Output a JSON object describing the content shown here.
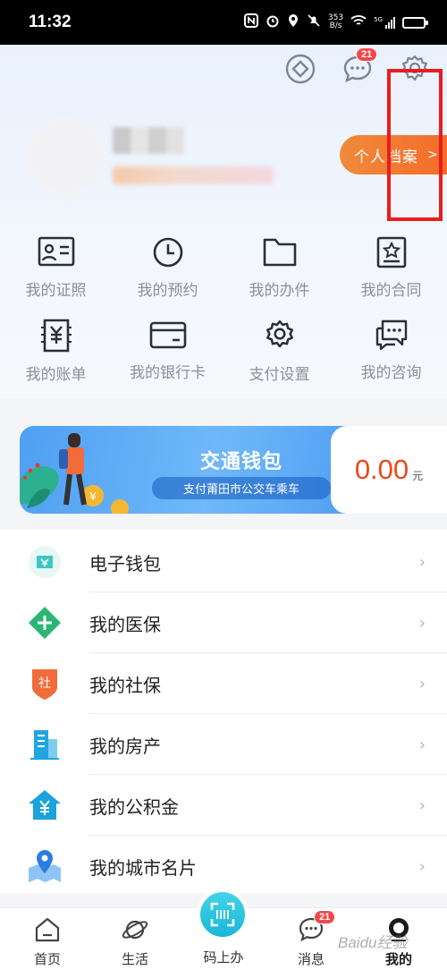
{
  "status": {
    "time": "11:32",
    "net_speed": "353",
    "net_unit": "B/s",
    "five_g": "5G"
  },
  "header": {
    "messages_badge": "21",
    "profile_button": "个人档案"
  },
  "services": [
    {
      "label": "我的证照",
      "icon": "id-card-icon"
    },
    {
      "label": "我的预约",
      "icon": "clock-icon"
    },
    {
      "label": "我的办件",
      "icon": "folder-icon"
    },
    {
      "label": "我的合同",
      "icon": "contract-icon"
    },
    {
      "label": "我的账单",
      "icon": "bill-icon"
    },
    {
      "label": "我的银行卡",
      "icon": "bank-card-icon"
    },
    {
      "label": "支付设置",
      "icon": "gear-icon"
    },
    {
      "label": "我的咨询",
      "icon": "consult-icon"
    }
  ],
  "wallet": {
    "title": "交通钱包",
    "subtitle": "支付莆田市公交车乘车",
    "amount": "0.00",
    "unit": "元"
  },
  "list": [
    {
      "label": "电子钱包",
      "icon": "e-wallet-icon",
      "color": "#3ec7c2"
    },
    {
      "label": "我的医保",
      "icon": "medical-insurance-icon",
      "color": "#2bb673"
    },
    {
      "label": "我的社保",
      "icon": "social-security-icon",
      "color": "#f26b3a"
    },
    {
      "label": "我的房产",
      "icon": "building-icon",
      "color": "#1fa6e0"
    },
    {
      "label": "我的公积金",
      "icon": "housing-fund-icon",
      "color": "#1aa3dc"
    },
    {
      "label": "我的城市名片",
      "icon": "city-card-icon",
      "color": "#2a7de1"
    }
  ],
  "chevron": "›",
  "tabbar": {
    "home": "首页",
    "life": "生活",
    "scan": "码上办",
    "messages": "消息",
    "messages_badge": "21",
    "mine": "我的"
  },
  "watermark": "Baidu经验"
}
